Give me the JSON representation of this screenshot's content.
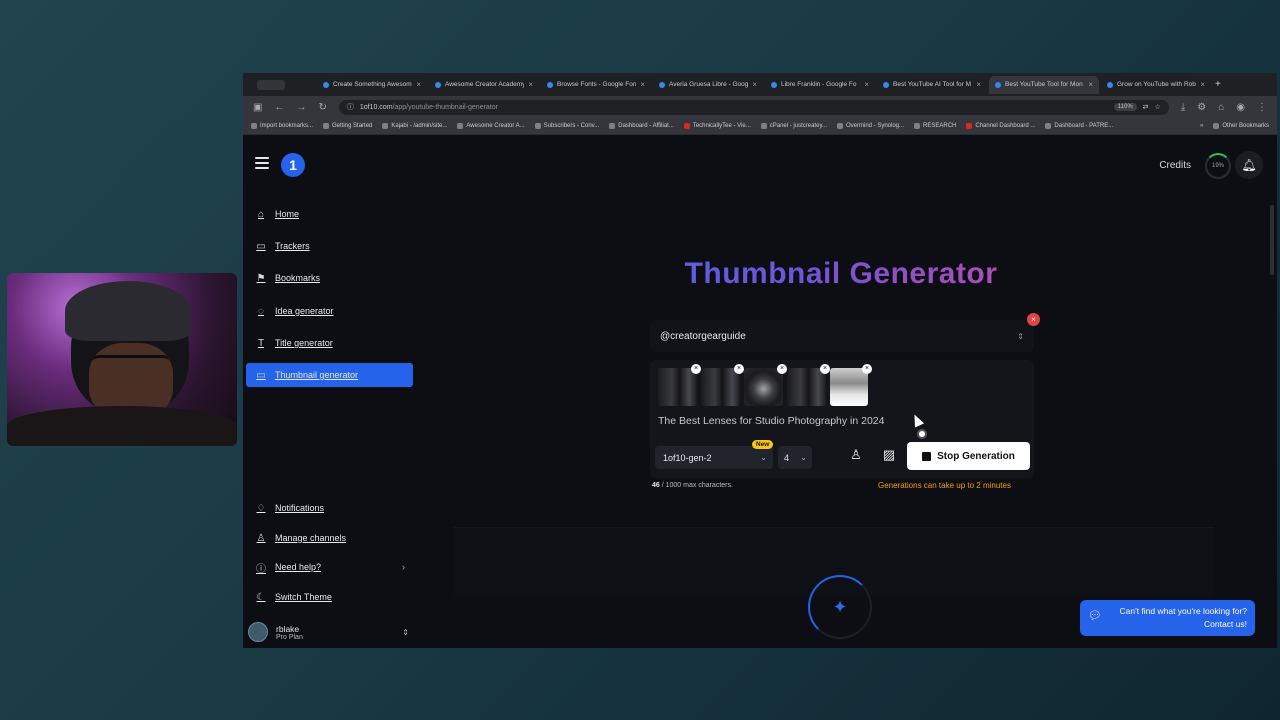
{
  "browser": {
    "tabs": [
      {
        "label": "Create Something Awesom"
      },
      {
        "label": "Awesome Creator Academy"
      },
      {
        "label": "Browse Fonts - Google Fon"
      },
      {
        "label": "Averia Gruesa Libre - Goog"
      },
      {
        "label": "Libre Franklin - Google Fo"
      },
      {
        "label": "Best YouTube AI Tool for M"
      },
      {
        "label": "Best YouTube Tool for Mon"
      },
      {
        "label": "Grow on YouTube with Rob"
      }
    ],
    "url_host": "1of10.com",
    "url_path": "/app/youtube-thumbnail-generator",
    "zoom": "110%",
    "bookmarks": [
      "Import bookmarks...",
      "Getting Started",
      "Kajabi - /admin/site...",
      "Awesome Creator A...",
      "Subscribers - Conv...",
      "Dashboard - Affiliat...",
      "TechnicallyTee - Vie...",
      "cPanel - justcreatey...",
      "Overmind - Synolog...",
      "RESEARCH",
      "Channel Dashboard ...",
      "Dashboard - PATRE...",
      "Other Bookmarks"
    ]
  },
  "header": {
    "logo": "1",
    "credits_label": "Credits",
    "credits_percent": "19%"
  },
  "sidebar": {
    "items": [
      {
        "label": "Home",
        "icon": "home-icon"
      },
      {
        "label": "Trackers",
        "icon": "folder-icon"
      },
      {
        "label": "Bookmarks",
        "icon": "bookmark-icon"
      },
      {
        "label": "Idea generator",
        "icon": "lightbulb-icon"
      },
      {
        "label": "Title generator",
        "icon": "text-icon"
      },
      {
        "label": "Thumbnail generator",
        "icon": "image-icon"
      }
    ],
    "bottom_items": [
      {
        "label": "Notifications",
        "icon": "bell-icon"
      },
      {
        "label": "Manage channels",
        "icon": "user-icon"
      },
      {
        "label": "Need help?",
        "icon": "info-icon"
      },
      {
        "label": "Switch Theme",
        "icon": "moon-icon"
      }
    ],
    "user": {
      "name": "rblake",
      "plan": "Pro Plan"
    }
  },
  "main": {
    "title": "Thumbnail Generator",
    "channel": "@creatorgearguide",
    "prompt": "The Best Lenses for Studio Photography in 2024",
    "model": "1of10-gen-2",
    "new_badge": "New",
    "count": "4",
    "stop_button": "Stop Generation",
    "char_count": "46",
    "char_limit": " / 1000 max characters.",
    "generation_note": "Generations can take up to 2 minutes"
  },
  "help": {
    "line1": "Can't find what you're looking for?",
    "line2": "Contact us!"
  },
  "colors": {
    "accent": "#2563eb",
    "warning": "#f59e0b",
    "badge": "#f5c518"
  }
}
